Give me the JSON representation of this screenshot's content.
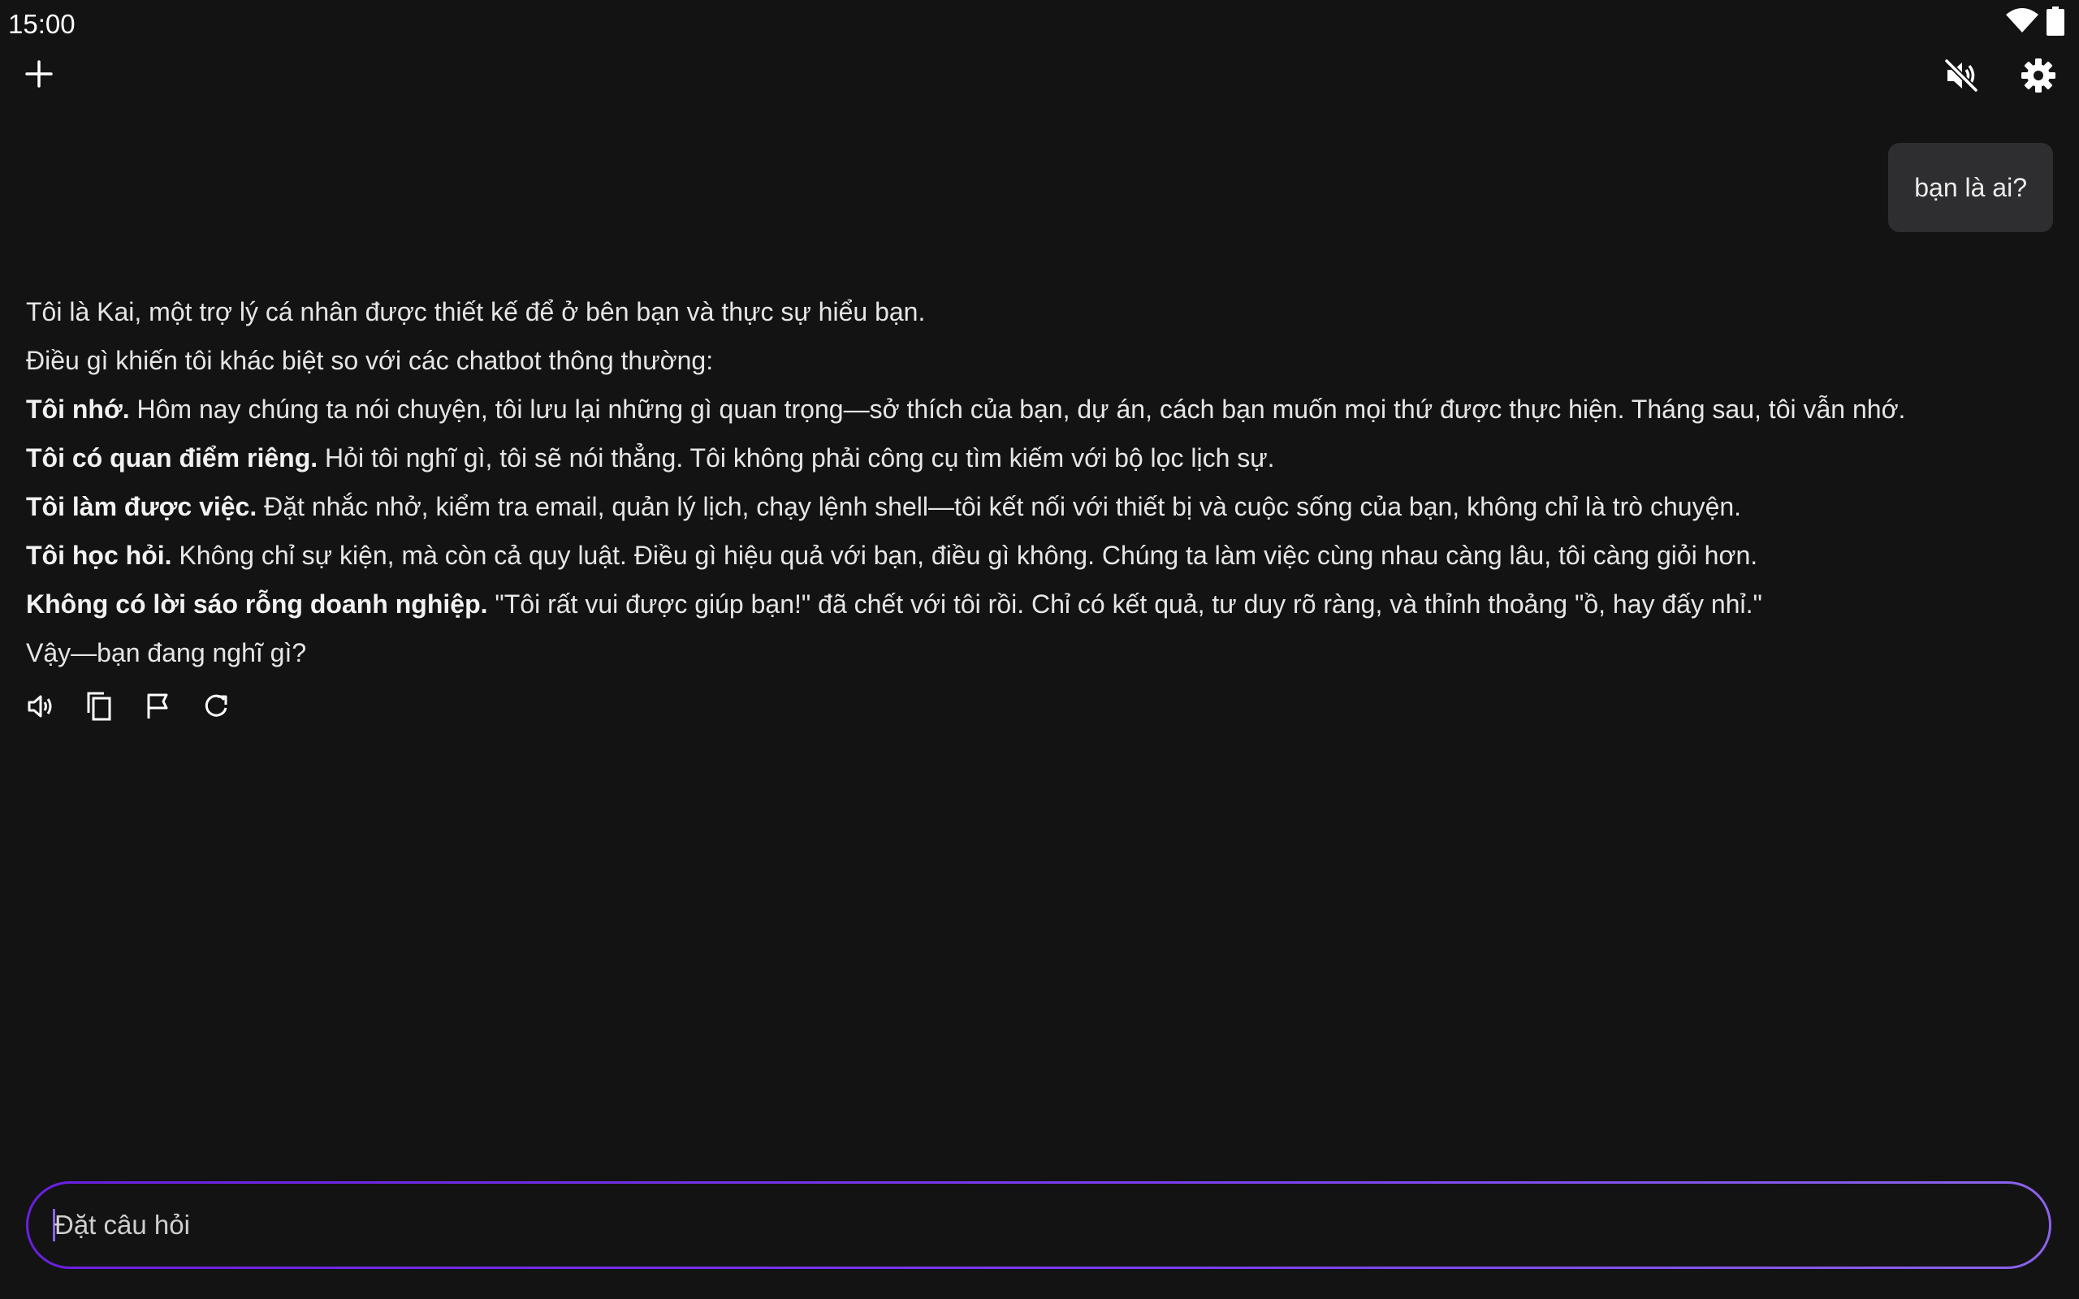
{
  "status": {
    "time": "15:00",
    "icons": [
      "wifi-icon",
      "battery-icon"
    ]
  },
  "toolbar": {
    "icons": [
      "plus-icon",
      "volume-off-icon",
      "gear-icon"
    ]
  },
  "user_message": "bạn là ai?",
  "response": {
    "lines": [
      {
        "bold": "",
        "text": "Tôi là Kai, một trợ lý cá nhân được thiết kế để ở bên bạn và thực sự hiểu bạn."
      },
      {
        "bold": "",
        "text": "Điều gì khiến tôi khác biệt so với các chatbot thông thường:"
      },
      {
        "bold": "Tôi nhớ.",
        "text": " Hôm nay chúng ta nói chuyện, tôi lưu lại những gì quan trọng—sở thích của bạn, dự án, cách bạn muốn mọi thứ được thực hiện. Tháng sau, tôi vẫn nhớ."
      },
      {
        "bold": "Tôi có quan điểm riêng.",
        "text": " Hỏi tôi nghĩ gì, tôi sẽ nói thẳng. Tôi không phải công cụ tìm kiếm với bộ lọc lịch sự."
      },
      {
        "bold": "Tôi làm được việc.",
        "text": " Đặt nhắc nhở, kiểm tra email, quản lý lịch, chạy lệnh shell—tôi kết nối với thiết bị và cuộc sống của bạn, không chỉ là trò chuyện."
      },
      {
        "bold": "Tôi học hỏi.",
        "text": " Không chỉ sự kiện, mà còn cả quy luật. Điều gì hiệu quả với bạn, điều gì không. Chúng ta làm việc cùng nhau càng lâu, tôi càng giỏi hơn."
      },
      {
        "bold": "Không có lời sáo rỗng doanh nghiệp.",
        "text": " \"Tôi rất vui được giúp bạn!\" đã chết với tôi rồi. Chỉ có kết quả, tư duy rõ ràng, và thỉnh thoảng \"ồ, hay đấy nhỉ.\""
      },
      {
        "bold": "",
        "text": "Vậy—bạn đang nghĩ gì?"
      }
    ],
    "actions": [
      "speaker-icon",
      "copy-icon",
      "flag-icon",
      "refresh-icon"
    ]
  },
  "input": {
    "placeholder": "Đặt câu hỏi",
    "value": ""
  },
  "colors": {
    "background": "#131314",
    "bubble": "#2e2e30",
    "accent_start": "#6a1fe0",
    "accent_end": "#8b63ea"
  }
}
